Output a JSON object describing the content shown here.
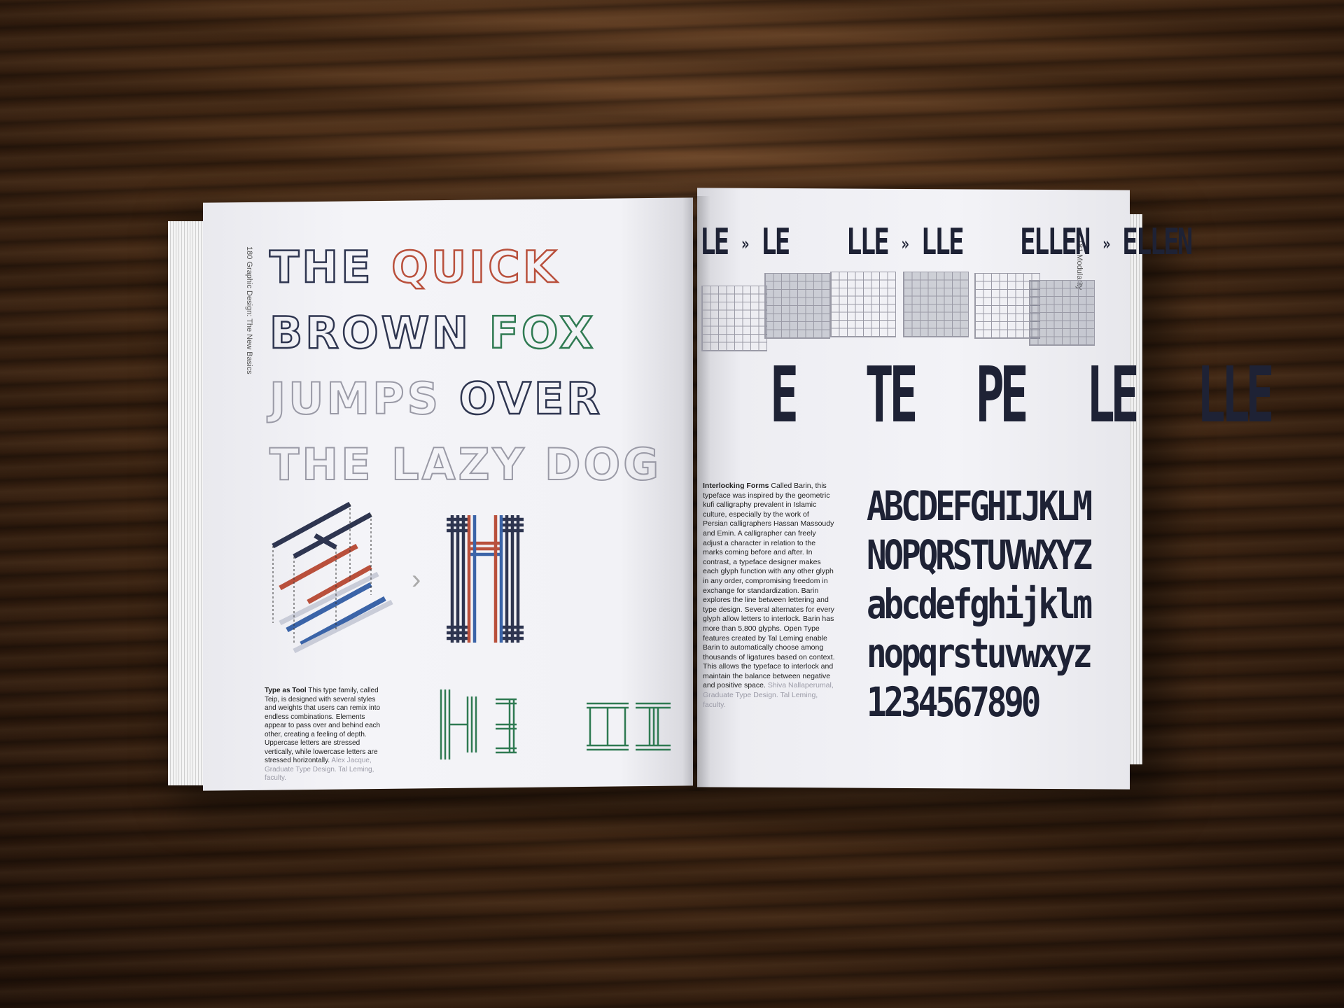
{
  "left_page": {
    "folio": "180 Graphic Design: The New Basics",
    "pangram": {
      "lines": [
        [
          {
            "text": "THE ",
            "color": "dark"
          },
          {
            "text": "QUICK",
            "color": "red"
          }
        ],
        [
          {
            "text": "BROWN ",
            "color": "dark"
          },
          {
            "text": "FOX",
            "color": "green"
          }
        ],
        [
          {
            "text": "JUMPS ",
            "color": "grey"
          },
          {
            "text": "OVER",
            "color": "dark"
          }
        ],
        [
          {
            "text": "THE LAZY DOG",
            "color": "grey"
          }
        ]
      ]
    },
    "caption": {
      "heading": "Type as Tool",
      "body": " This type family, called Teip, is designed with several styles and weights that users can remix into endless combinations. Elements appear to pass over and behind each other, creating a feeling of depth. Uppercase letters are stressed vertically, while lowercase letters are stressed horizontally. ",
      "credit": "Alex Jacque, Graduate Type Design. Tal Leming, faculty."
    },
    "arrow_glyph": "›"
  },
  "right_page": {
    "folio": "181 Modularity",
    "ligature_row": [
      {
        "from": "LE",
        "to": "LE"
      },
      {
        "from": "LLE",
        "to": "LLE"
      },
      {
        "from": "ELLEN",
        "to": "ELLEN"
      }
    ],
    "arrow_glyph": "»",
    "glyph_row": [
      "E",
      "TE",
      "PE",
      "LE",
      "LLE"
    ],
    "caption": {
      "heading": "Interlocking Forms",
      "body": " Called Barin, this typeface was inspired by the geometric kufi calligraphy prevalent in Islamic culture, especially by the work of Persian calligraphers Hassan Massoudy and Emin. A calligrapher can freely adjust a character in relation to the marks coming before and after. In contrast, a typeface designer makes each glyph function with any other glyph in any order, compromising freedom in exchange for standardization. Barin explores the line between lettering and type design. Several alternates for every glyph allow letters to interlock. Barin has more than 5,800 glyphs. Open Type features created by Tal Leming enable Barin to automatically choose among thousands of ligatures based on context. This allows the typeface to interlock and maintain the balance between negative and positive space. ",
      "credit": "Shiva Nallaperumal, Graduate Type Design. Tal Leming, faculty."
    },
    "alphabet": {
      "upper_1": "ABCDEFGHIJKLM",
      "upper_2": "NOPQRSTUVWXYZ",
      "lower_1": "abcdefghijklm",
      "lower_2": "nopqrstuvwxyz",
      "digits": "1234567890"
    }
  },
  "colors": {
    "dark": "#2e3550",
    "red": "#b9503c",
    "green": "#2f7a52",
    "grey": "#9a9aa6",
    "blue": "#3b64a8",
    "ink": "#1e2235"
  }
}
